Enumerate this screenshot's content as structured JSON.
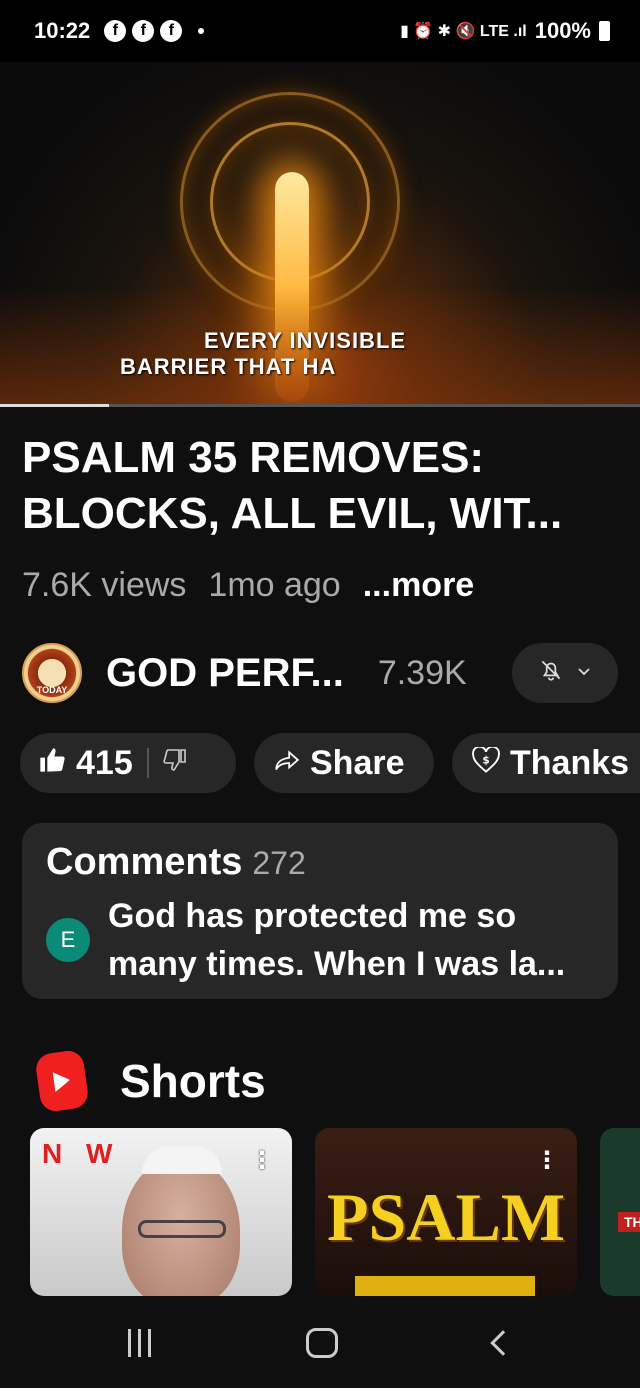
{
  "status_bar": {
    "time": "10:22",
    "notification_icons": [
      "f",
      "f",
      "f"
    ],
    "right_icons": "▮ ⏰ ✱ 🔇 LTE .ıl",
    "battery": "100%"
  },
  "video": {
    "caption_line1": "EVERY INVISIBLE",
    "caption_line2": "BARRIER THAT HA",
    "progress": 0.17
  },
  "title": "PSALM 35 REMOVES: BLOCKS, ALL EVIL, WIT...",
  "meta": {
    "views": "7.6K views",
    "age": "1mo ago",
    "more": "...more"
  },
  "channel": {
    "avatar_text": "TODAY",
    "name": "GOD PERF...",
    "subscribers": "7.39K",
    "bell_icon": "bell-off-icon"
  },
  "actions": {
    "likes": "415",
    "share_label": "Share",
    "thanks_label": "Thanks"
  },
  "comments": {
    "heading": "Comments",
    "count": "272",
    "avatar_letter": "E",
    "preview": "God has protected me so many times. When I was la..."
  },
  "shorts": {
    "heading": "Shorts",
    "items": [
      {
        "overlay_text": "N W"
      },
      {
        "overlay_text": "PSALM"
      },
      {
        "overlay_text": "TH"
      }
    ]
  },
  "colors": {
    "background": "#0f0f0f",
    "pill": "#272727",
    "shorts_red": "#f02020",
    "comment_avatar": "#0c8a78"
  }
}
